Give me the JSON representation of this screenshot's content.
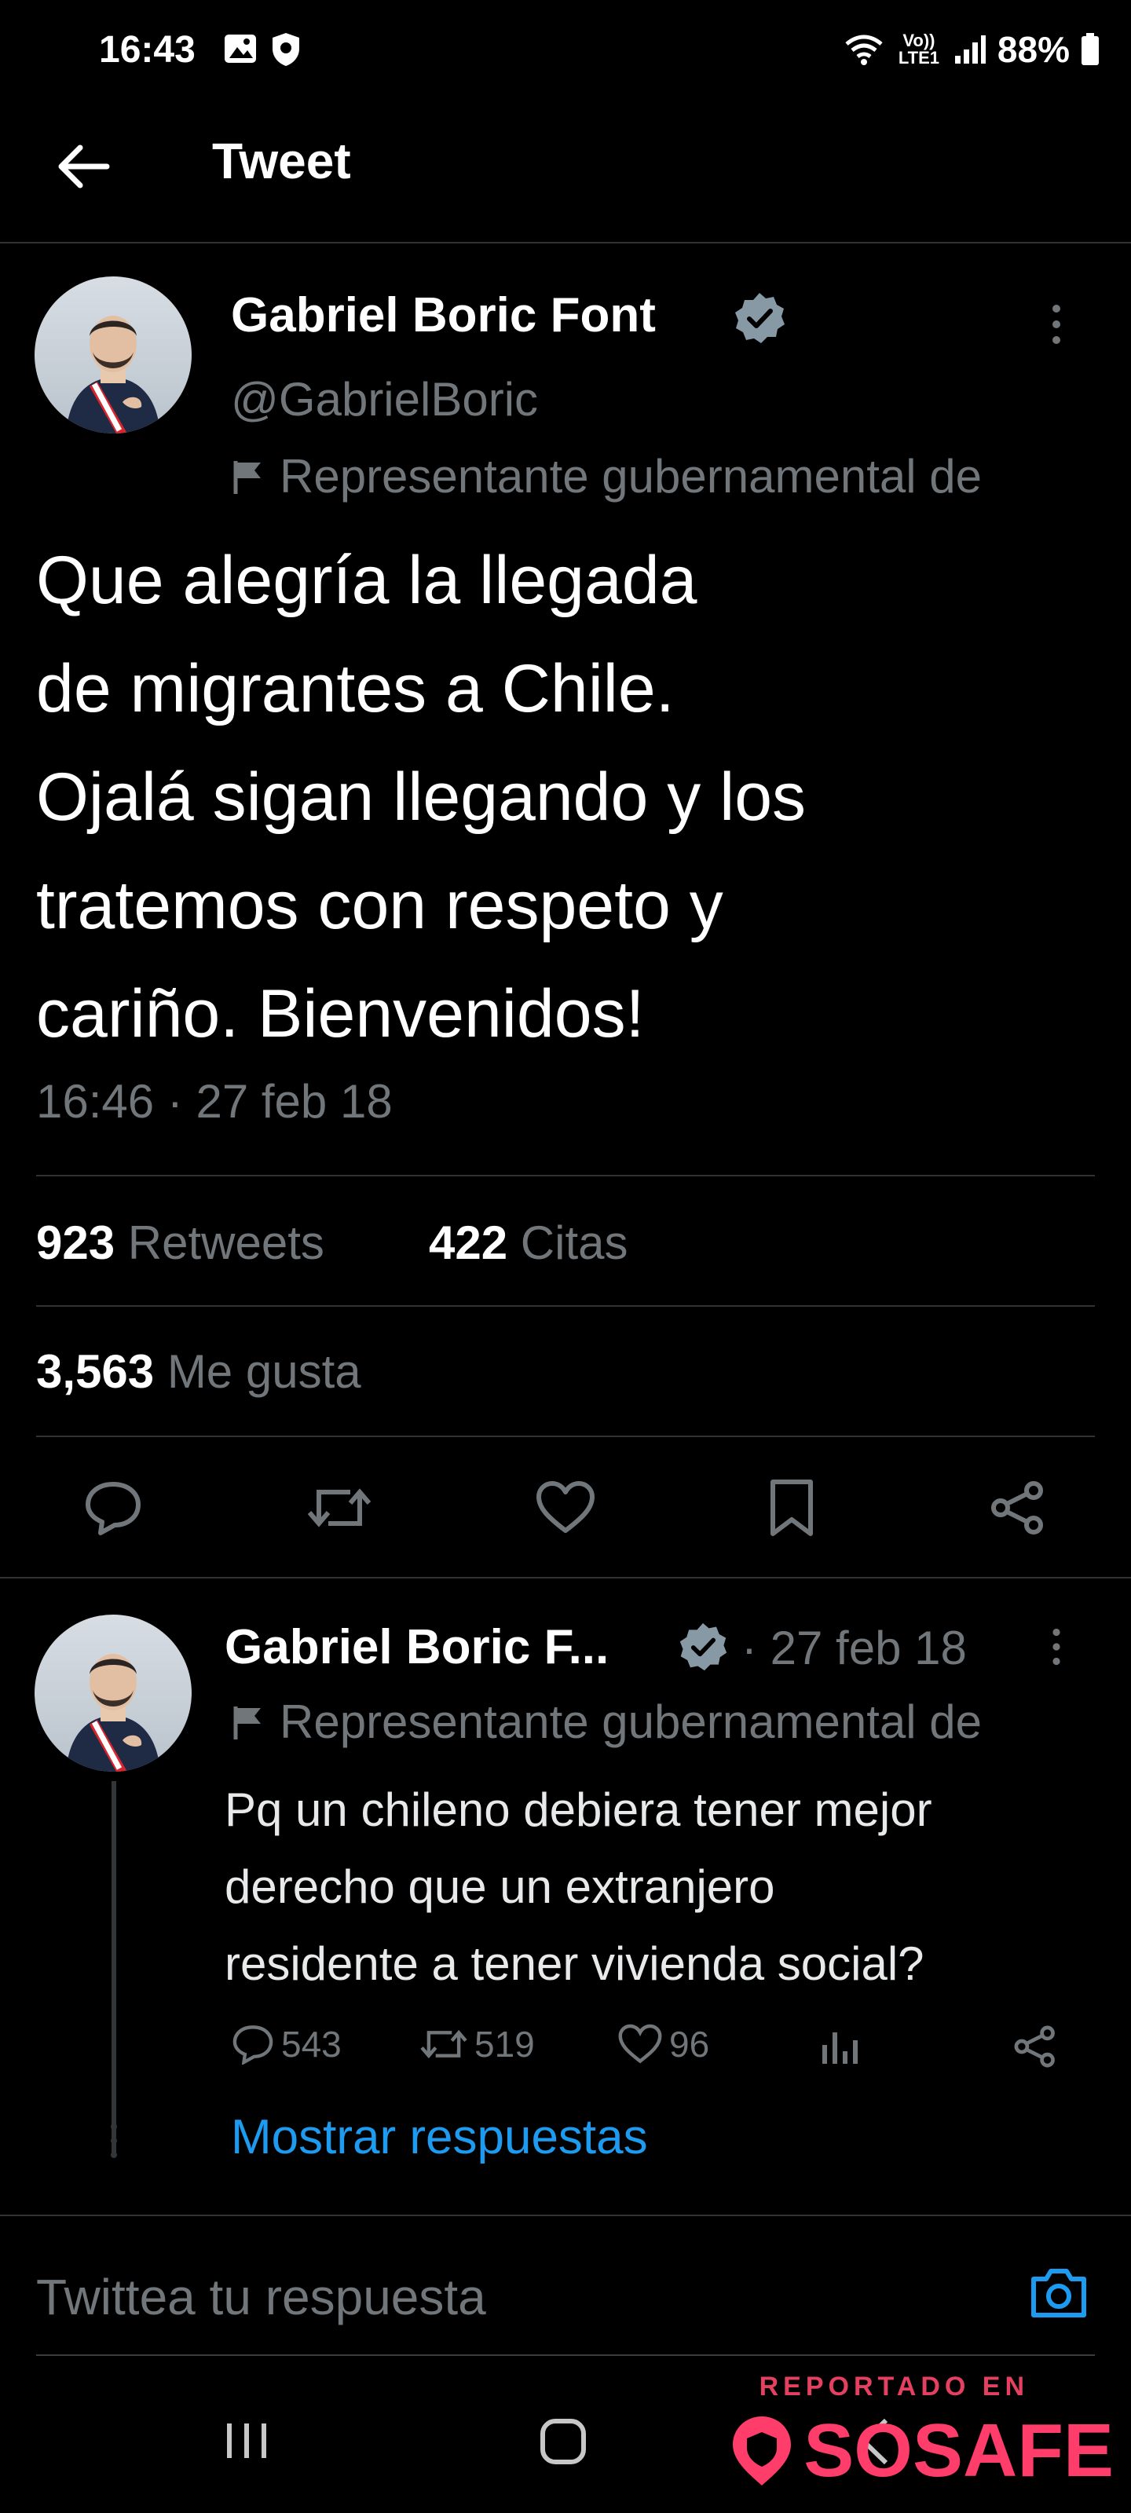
{
  "status_bar": {
    "time": "16:43",
    "battery": "88%",
    "network_label": "Vo)) LTE1"
  },
  "header": {
    "title": "Tweet"
  },
  "tweet": {
    "author_name": "Gabriel Boric Font",
    "handle": "@GabrielBoric",
    "account_label": "Representante gubernamental de",
    "text_lines": [
      "Que alegría la llegada",
      "de migrantes a Chile.",
      "Ojalá sigan llegando y los",
      "tratemos con respeto y",
      "cariño. Bienvenidos!"
    ],
    "timestamp": "16:46 · 27 feb 18",
    "retweets_count": "923",
    "retweets_label": "Retweets",
    "quotes_count": "422",
    "quotes_label": "Citas",
    "likes_count": "3,563",
    "likes_label": "Me gusta"
  },
  "reply": {
    "author_name": "Gabriel Boric F...",
    "date": "· 27 feb 18",
    "account_label": "Representante gubernamental de",
    "text_lines": [
      "Pq un chileno debiera tener mejor",
      "derecho que un extranjero",
      "residente a tener vivienda social?"
    ],
    "replies": "543",
    "retweets": "519",
    "likes": "96",
    "show_replies": "Mostrar respuestas"
  },
  "compose": {
    "placeholder": "Twittea tu respuesta"
  },
  "watermark": {
    "top": "REPORTADO EN",
    "brand": "SOSAFE"
  },
  "colors": {
    "background": "#000000",
    "accent": "#1d9bf0",
    "secondary_text": "#71767b",
    "watermark": "#ff3d6a"
  }
}
